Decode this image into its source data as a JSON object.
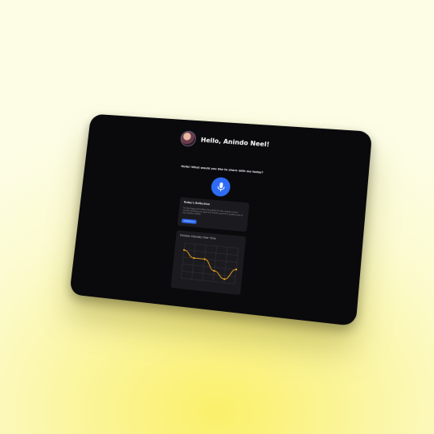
{
  "header": {
    "greeting": "Hello, Anindo Neel!"
  },
  "prompt": "Hello! What would you like to share with me today?",
  "mic": {
    "icon": "microphone-icon",
    "color": "#2f6cf5"
  },
  "reflection": {
    "title": "Today's Reflection",
    "text": "You feel happy and fulfilled. Be grateful for this, despite a minor accident. Building your goals and memory good for a positive push to your positive outlook.",
    "button": "Get Back to it"
  },
  "chart": {
    "title": "Emotion Intensity Over Time"
  },
  "chart_data": {
    "type": "line",
    "title": "Emotion Intensity Over Time",
    "x": [
      1,
      2,
      3,
      4,
      5,
      6
    ],
    "series": [
      {
        "values": [
          8,
          6,
          6,
          3,
          1,
          4
        ]
      }
    ],
    "ylim": [
      0,
      10
    ],
    "grid": true,
    "line_color": "#f0a623"
  }
}
